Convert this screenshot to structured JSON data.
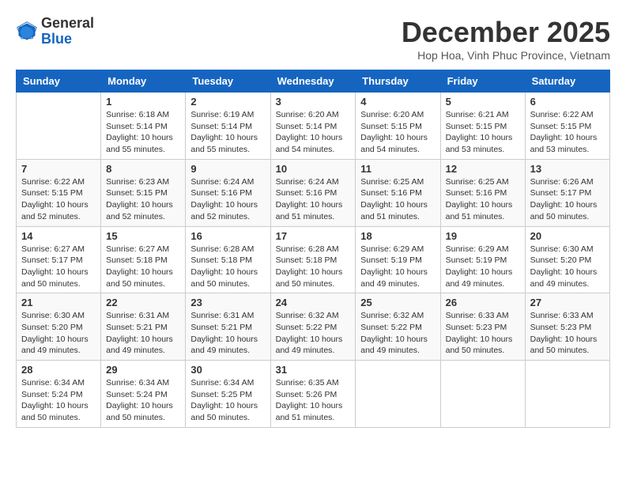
{
  "header": {
    "logo_general": "General",
    "logo_blue": "Blue",
    "month_title": "December 2025",
    "location": "Hop Hoa, Vinh Phuc Province, Vietnam"
  },
  "days_of_week": [
    "Sunday",
    "Monday",
    "Tuesday",
    "Wednesday",
    "Thursday",
    "Friday",
    "Saturday"
  ],
  "weeks": [
    [
      {
        "day": "",
        "info": ""
      },
      {
        "day": "1",
        "info": "Sunrise: 6:18 AM\nSunset: 5:14 PM\nDaylight: 10 hours\nand 55 minutes."
      },
      {
        "day": "2",
        "info": "Sunrise: 6:19 AM\nSunset: 5:14 PM\nDaylight: 10 hours\nand 55 minutes."
      },
      {
        "day": "3",
        "info": "Sunrise: 6:20 AM\nSunset: 5:14 PM\nDaylight: 10 hours\nand 54 minutes."
      },
      {
        "day": "4",
        "info": "Sunrise: 6:20 AM\nSunset: 5:15 PM\nDaylight: 10 hours\nand 54 minutes."
      },
      {
        "day": "5",
        "info": "Sunrise: 6:21 AM\nSunset: 5:15 PM\nDaylight: 10 hours\nand 53 minutes."
      },
      {
        "day": "6",
        "info": "Sunrise: 6:22 AM\nSunset: 5:15 PM\nDaylight: 10 hours\nand 53 minutes."
      }
    ],
    [
      {
        "day": "7",
        "info": "Sunrise: 6:22 AM\nSunset: 5:15 PM\nDaylight: 10 hours\nand 52 minutes."
      },
      {
        "day": "8",
        "info": "Sunrise: 6:23 AM\nSunset: 5:15 PM\nDaylight: 10 hours\nand 52 minutes."
      },
      {
        "day": "9",
        "info": "Sunrise: 6:24 AM\nSunset: 5:16 PM\nDaylight: 10 hours\nand 52 minutes."
      },
      {
        "day": "10",
        "info": "Sunrise: 6:24 AM\nSunset: 5:16 PM\nDaylight: 10 hours\nand 51 minutes."
      },
      {
        "day": "11",
        "info": "Sunrise: 6:25 AM\nSunset: 5:16 PM\nDaylight: 10 hours\nand 51 minutes."
      },
      {
        "day": "12",
        "info": "Sunrise: 6:25 AM\nSunset: 5:16 PM\nDaylight: 10 hours\nand 51 minutes."
      },
      {
        "day": "13",
        "info": "Sunrise: 6:26 AM\nSunset: 5:17 PM\nDaylight: 10 hours\nand 50 minutes."
      }
    ],
    [
      {
        "day": "14",
        "info": "Sunrise: 6:27 AM\nSunset: 5:17 PM\nDaylight: 10 hours\nand 50 minutes."
      },
      {
        "day": "15",
        "info": "Sunrise: 6:27 AM\nSunset: 5:18 PM\nDaylight: 10 hours\nand 50 minutes."
      },
      {
        "day": "16",
        "info": "Sunrise: 6:28 AM\nSunset: 5:18 PM\nDaylight: 10 hours\nand 50 minutes."
      },
      {
        "day": "17",
        "info": "Sunrise: 6:28 AM\nSunset: 5:18 PM\nDaylight: 10 hours\nand 50 minutes."
      },
      {
        "day": "18",
        "info": "Sunrise: 6:29 AM\nSunset: 5:19 PM\nDaylight: 10 hours\nand 49 minutes."
      },
      {
        "day": "19",
        "info": "Sunrise: 6:29 AM\nSunset: 5:19 PM\nDaylight: 10 hours\nand 49 minutes."
      },
      {
        "day": "20",
        "info": "Sunrise: 6:30 AM\nSunset: 5:20 PM\nDaylight: 10 hours\nand 49 minutes."
      }
    ],
    [
      {
        "day": "21",
        "info": "Sunrise: 6:30 AM\nSunset: 5:20 PM\nDaylight: 10 hours\nand 49 minutes."
      },
      {
        "day": "22",
        "info": "Sunrise: 6:31 AM\nSunset: 5:21 PM\nDaylight: 10 hours\nand 49 minutes."
      },
      {
        "day": "23",
        "info": "Sunrise: 6:31 AM\nSunset: 5:21 PM\nDaylight: 10 hours\nand 49 minutes."
      },
      {
        "day": "24",
        "info": "Sunrise: 6:32 AM\nSunset: 5:22 PM\nDaylight: 10 hours\nand 49 minutes."
      },
      {
        "day": "25",
        "info": "Sunrise: 6:32 AM\nSunset: 5:22 PM\nDaylight: 10 hours\nand 49 minutes."
      },
      {
        "day": "26",
        "info": "Sunrise: 6:33 AM\nSunset: 5:23 PM\nDaylight: 10 hours\nand 50 minutes."
      },
      {
        "day": "27",
        "info": "Sunrise: 6:33 AM\nSunset: 5:23 PM\nDaylight: 10 hours\nand 50 minutes."
      }
    ],
    [
      {
        "day": "28",
        "info": "Sunrise: 6:34 AM\nSunset: 5:24 PM\nDaylight: 10 hours\nand 50 minutes."
      },
      {
        "day": "29",
        "info": "Sunrise: 6:34 AM\nSunset: 5:24 PM\nDaylight: 10 hours\nand 50 minutes."
      },
      {
        "day": "30",
        "info": "Sunrise: 6:34 AM\nSunset: 5:25 PM\nDaylight: 10 hours\nand 50 minutes."
      },
      {
        "day": "31",
        "info": "Sunrise: 6:35 AM\nSunset: 5:26 PM\nDaylight: 10 hours\nand 51 minutes."
      },
      {
        "day": "",
        "info": ""
      },
      {
        "day": "",
        "info": ""
      },
      {
        "day": "",
        "info": ""
      }
    ]
  ]
}
